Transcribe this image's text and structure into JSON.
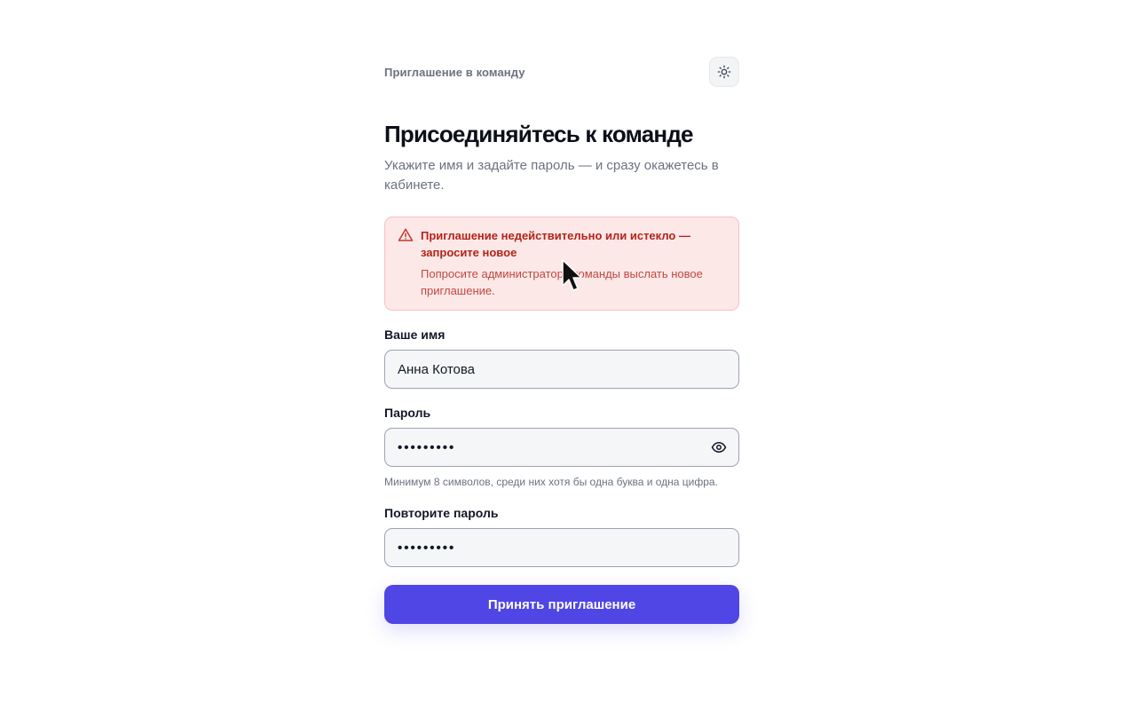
{
  "header": {
    "eyebrow": "Приглашение в команду",
    "theme_toggle_icon": "sun-icon"
  },
  "main": {
    "title": "Присоединяйтесь к команде",
    "subtitle": "Укажите имя и задайте пароль — и сразу окажетесь в кабинете."
  },
  "alert": {
    "icon": "warning-triangle-icon",
    "title": "Приглашение недействительно или истекло — запросите новое",
    "text": "Попросите администратора команды выслать новое приглашение.",
    "color": "#b42318",
    "background": "#fde8e8"
  },
  "form": {
    "name": {
      "label": "Ваше имя",
      "value": "Анна Котова"
    },
    "password": {
      "label": "Пароль",
      "value": "•••••••••",
      "toggle_icon": "eye-icon",
      "hint": "Минимум 8 символов, среди них хотя бы одна буква и одна цифра."
    },
    "repeat_password": {
      "label": "Повторите пароль",
      "value": "•••••••••"
    },
    "submit_label": "Принять приглашение",
    "accent_color": "#4f46e5"
  }
}
